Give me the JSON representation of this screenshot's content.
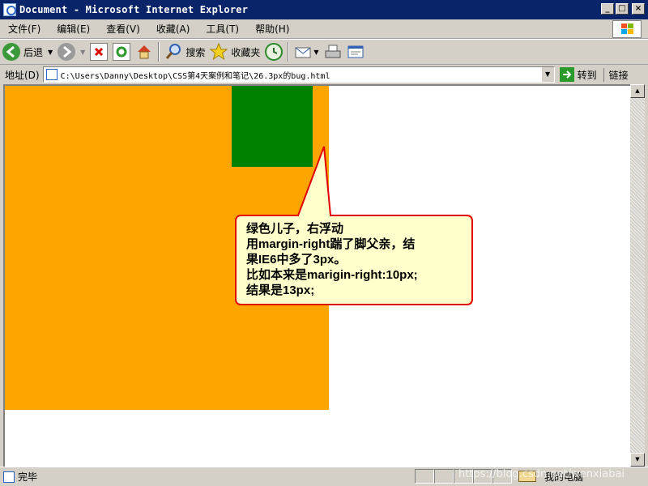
{
  "window": {
    "title": "Document - Microsoft Internet Explorer",
    "controls": {
      "minimize": "_",
      "maximize": "□",
      "close": "×"
    }
  },
  "menu": {
    "items": [
      "文件(F)",
      "编辑(E)",
      "查看(V)",
      "收藏(A)",
      "工具(T)",
      "帮助(H)"
    ]
  },
  "toolbar": {
    "back_label": "后退",
    "search_label": "搜索",
    "favorites_label": "收藏夹"
  },
  "address": {
    "label": "地址(D)",
    "value": "C:\\Users\\Danny\\Desktop\\CSS第4天案例和笔记\\26.3px的bug.html",
    "go_label": "转到",
    "links_label": "链接"
  },
  "content": {
    "parent_color": "#ffa500",
    "child_color": "#008000"
  },
  "callout": {
    "lines": [
      "绿色儿子，右浮动",
      "用margin-right踹了脚父亲，结",
      "果IE6中多了3px。",
      "比如本来是marigin-right:10px;",
      "结果是13px;"
    ],
    "border_color": "#e30000",
    "fill_color": "#ffffcc"
  },
  "status": {
    "text": "完毕",
    "zone": "我的电脑",
    "watermark": "https://blog.csdn.net/wenxiabai"
  }
}
